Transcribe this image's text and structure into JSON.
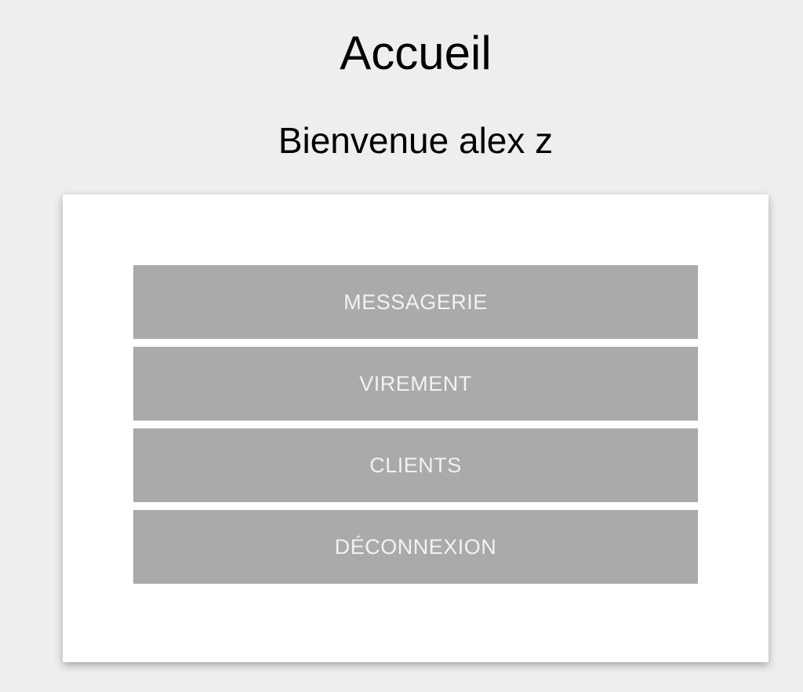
{
  "header": {
    "title": "Accueil",
    "welcome": "Bienvenue alex z"
  },
  "menu": {
    "items": [
      {
        "label": "MESSAGERIE"
      },
      {
        "label": "VIREMENT"
      },
      {
        "label": "CLIENTS"
      },
      {
        "label": "DÉCONNEXION"
      }
    ]
  },
  "colors": {
    "background": "#eeeeee",
    "card": "#ffffff",
    "button": "#aaaaaa",
    "button_text": "#f2f2f2"
  }
}
